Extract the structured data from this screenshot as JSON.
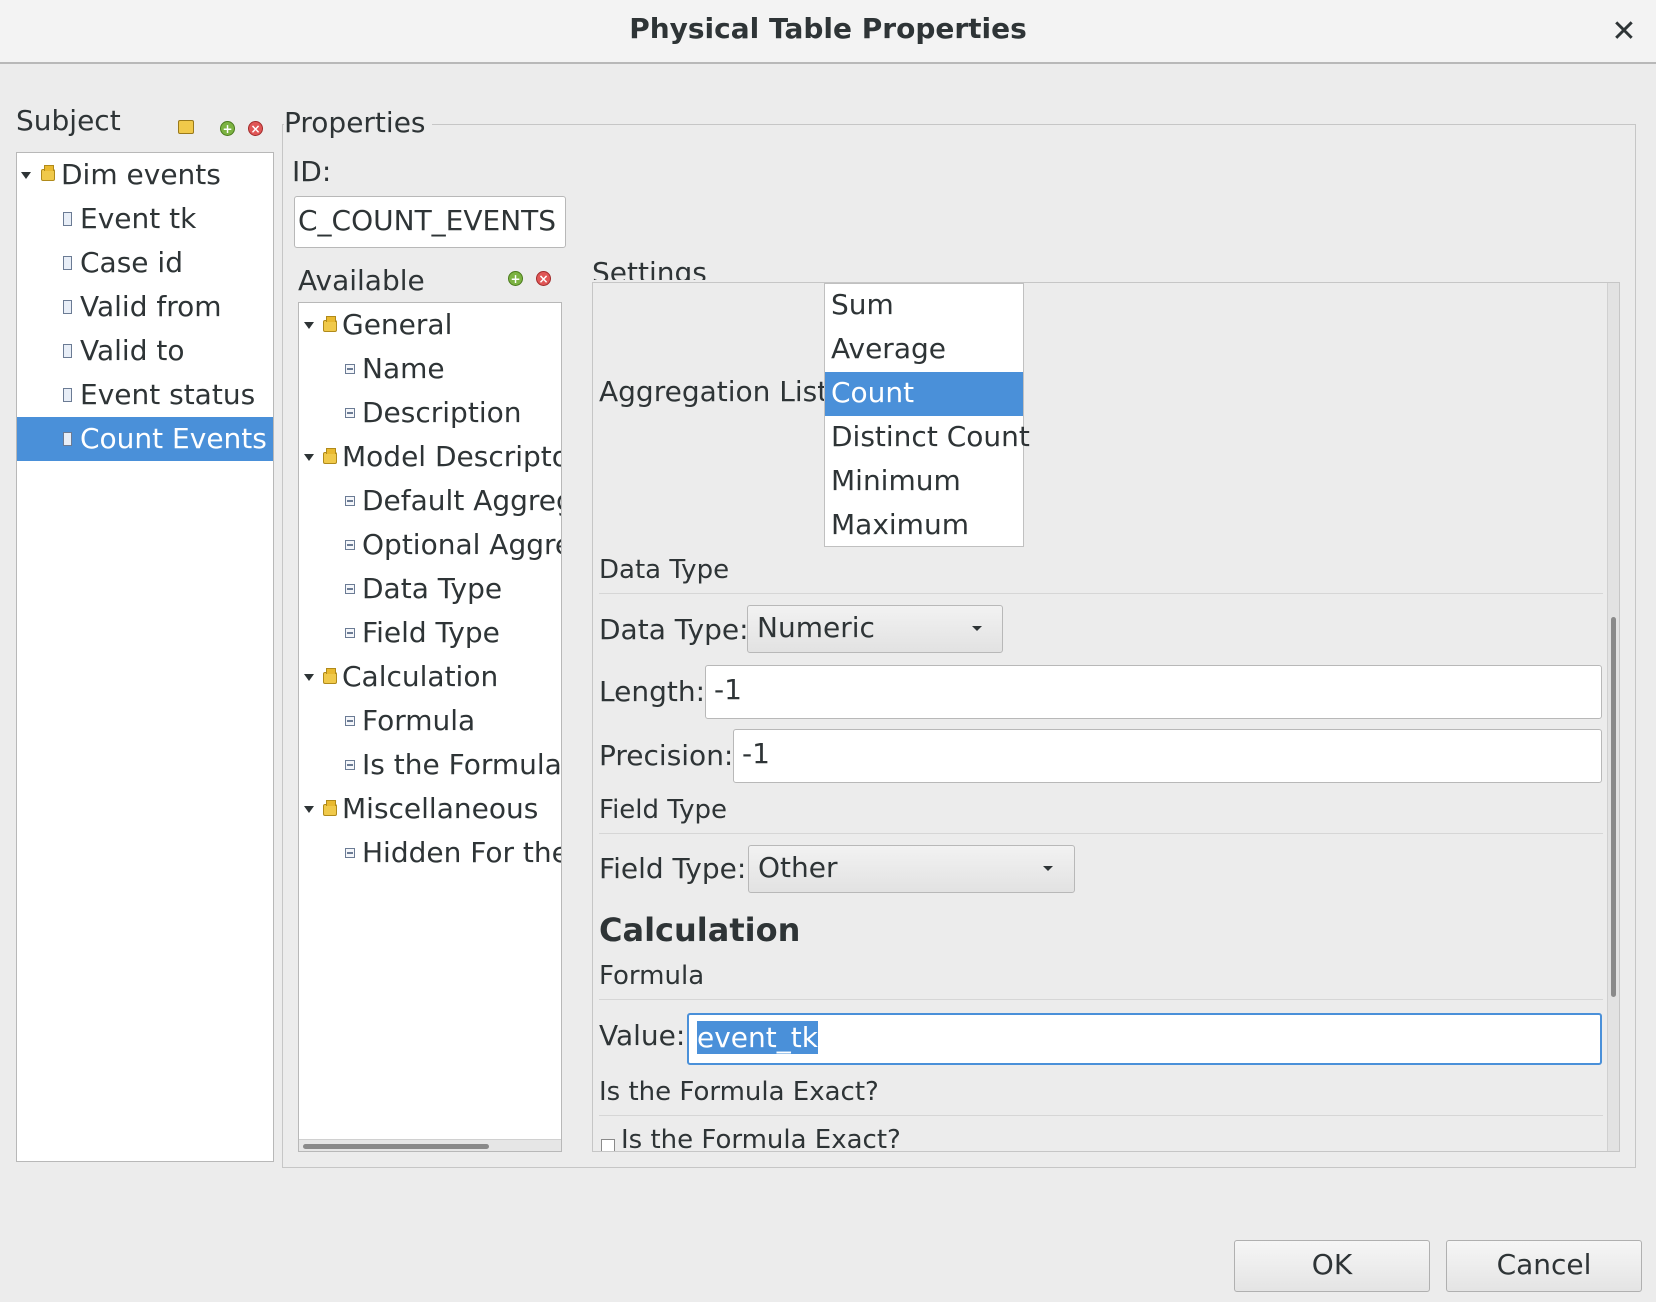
{
  "window": {
    "title": "Physical Table Properties",
    "close_glyph": "✕"
  },
  "subject": {
    "label": "Subject",
    "root": "Dim events",
    "items": [
      "Event tk",
      "Case id",
      "Valid from",
      "Valid to",
      "Event status",
      "Count Events"
    ],
    "selected": "Count Events"
  },
  "properties": {
    "label": "Properties",
    "id_label": "ID:",
    "id_value": "C_COUNT_EVENTS"
  },
  "available": {
    "label": "Available",
    "groups": [
      {
        "name": "General",
        "items": [
          "Name",
          "Description"
        ]
      },
      {
        "name": "Model Descriptor",
        "items": [
          "Default Aggrega",
          "Optional Aggreg",
          "Data Type",
          "Field Type"
        ]
      },
      {
        "name": "Calculation",
        "items": [
          "Formula",
          "Is the Formula E"
        ]
      },
      {
        "name": "Miscellaneous",
        "items": [
          "Hidden For the"
        ]
      }
    ]
  },
  "settings": {
    "label": "Settings",
    "aggregation_label": "Aggregation List:",
    "aggregation_options": [
      "Sum",
      "Average",
      "Count",
      "Distinct Count",
      "Minimum",
      "Maximum"
    ],
    "aggregation_selected": "Count",
    "data_type_section": "Data Type",
    "data_type_label": "Data Type:",
    "data_type_value": "Numeric",
    "length_label": "Length:",
    "length_value": "-1",
    "precision_label": "Precision:",
    "precision_value": "-1",
    "field_type_section": "Field Type",
    "field_type_label": "Field Type:",
    "field_type_value": "Other",
    "calculation_heading": "Calculation",
    "formula_section": "Formula",
    "value_label": "Value:",
    "value_text": "event_tk",
    "exact_section": "Is the Formula Exact?",
    "exact_checkbox_label": "Is the Formula Exact?"
  },
  "buttons": {
    "ok": "OK",
    "cancel": "Cancel"
  },
  "colors": {
    "selection": "#4a90d9",
    "background": "#ececec"
  }
}
